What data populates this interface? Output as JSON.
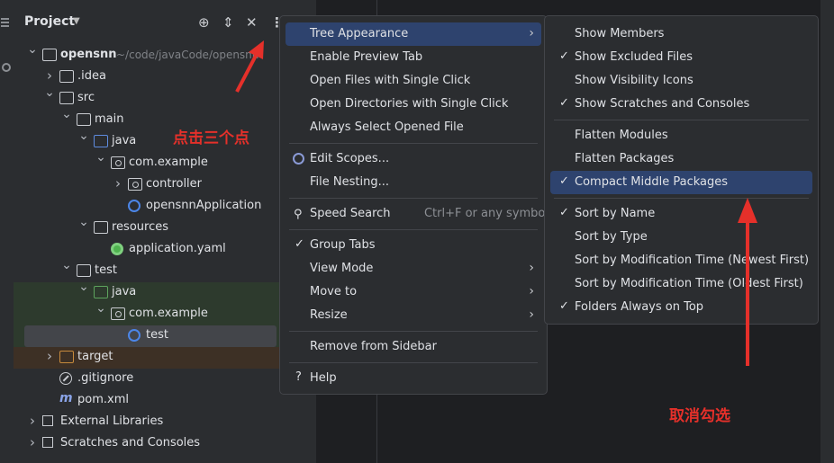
{
  "project": {
    "title": "Project",
    "tree": [
      {
        "label": "opensnn",
        "path": "~/code/javaCode/opensnn",
        "level": 0,
        "arrow": "down",
        "icon": "folder"
      },
      {
        "label": ".idea",
        "level": 1,
        "arrow": "right",
        "icon": "folder"
      },
      {
        "label": "src",
        "level": 1,
        "arrow": "down",
        "icon": "folder"
      },
      {
        "label": "main",
        "level": 2,
        "arrow": "down",
        "icon": "folder"
      },
      {
        "label": "java",
        "level": 3,
        "arrow": "down",
        "icon": "folder-blue"
      },
      {
        "label": "com.example",
        "level": 4,
        "arrow": "down",
        "icon": "package"
      },
      {
        "label": "controller",
        "level": 5,
        "arrow": "right",
        "icon": "package"
      },
      {
        "label": "opensnnApplication",
        "level": 5,
        "arrow": "",
        "icon": "class"
      },
      {
        "label": "resources",
        "level": 3,
        "arrow": "down",
        "icon": "folder-resources"
      },
      {
        "label": "application.yaml",
        "level": 4,
        "arrow": "",
        "icon": "yaml"
      },
      {
        "label": "test",
        "level": 2,
        "arrow": "down",
        "icon": "folder"
      },
      {
        "label": "java",
        "level": 3,
        "arrow": "down",
        "icon": "folder-green"
      },
      {
        "label": "com.example",
        "level": 4,
        "arrow": "down",
        "icon": "package"
      },
      {
        "label": "test",
        "level": 5,
        "arrow": "",
        "icon": "class"
      },
      {
        "label": "target",
        "level": 1,
        "arrow": "right",
        "icon": "folder-orange"
      },
      {
        "label": ".gitignore",
        "level": 1,
        "arrow": "",
        "icon": "gitignore"
      },
      {
        "label": "pom.xml",
        "level": 1,
        "arrow": "",
        "icon": "maven"
      },
      {
        "label": "External Libraries",
        "level": 0,
        "arrow": "right",
        "icon": "libraries"
      },
      {
        "label": "Scratches and Consoles",
        "level": 0,
        "arrow": "right",
        "icon": "scratches"
      }
    ]
  },
  "menu": {
    "tree_appearance": "Tree Appearance",
    "enable_preview_tab": "Enable Preview Tab",
    "open_files_single_click": "Open Files with Single Click",
    "open_dirs_single_click": "Open Directories with Single Click",
    "always_select_opened": "Always Select Opened File",
    "edit_scopes": "Edit Scopes...",
    "file_nesting": "File Nesting...",
    "speed_search": "Speed Search",
    "speed_search_shortcut": "Ctrl+F or any symbol",
    "group_tabs": "Group Tabs",
    "view_mode": "View Mode",
    "move_to": "Move to",
    "resize": "Resize",
    "remove_from_sidebar": "Remove from Sidebar",
    "help": "Help"
  },
  "submenu": {
    "show_members": "Show Members",
    "show_excluded_files": "Show Excluded Files",
    "show_visibility_icons": "Show Visibility Icons",
    "show_scratches": "Show Scratches and Consoles",
    "flatten_modules": "Flatten Modules",
    "flatten_packages": "Flatten Packages",
    "compact_middle": "Compact Middle Packages",
    "sort_by_name": "Sort by Name",
    "sort_by_type": "Sort by Type",
    "sort_mod_newest": "Sort by Modification Time (Newest First)",
    "sort_mod_oldest": "Sort by Modification Time (Oldest First)",
    "folders_on_top": "Folders Always on Top"
  },
  "annotations": {
    "click_three_dots": "点击三个点",
    "uncheck": "取消勾选"
  },
  "colors": {
    "accent": "#2e436e",
    "annotation": "#e5302a"
  }
}
